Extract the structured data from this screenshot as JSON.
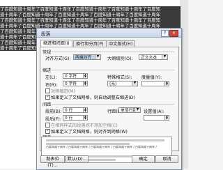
{
  "document": {
    "lines": [
      "了百度知道十周年了百度知道十周年了百度知道十周年了百度知道十周年了百度知",
      "道十周年了百度知道十周年了百度知道十周年了百度知道十周年了百度知道十周年",
      "了百度知道十周年了百度知道十周年了百度知道十周年了百度知道十周年了百度知",
      "道十周年了百度知道十周年了百度知道十周年了百度知道十周年了百度知道十周年",
      "了百度知道十周年了百度知道十周年了百度知道十周年了百度知道十周年了百度知",
      "道十周年了百度知道十周年了百度知道十周年了百度知道十周年了百度知道十周年",
      "了百度知道十周年了百度知道十周年了百度知道十周年了百度知道十周年了百度知",
      "道十周年了百度知道十周年了百度知道十周年了百度知道十周年了百度知道十周年"
    ]
  },
  "dialog": {
    "title": "段落",
    "help": "?",
    "close": "✕",
    "tabs": [
      "缩进和间距(I)",
      "换行和分页(P)",
      "中文版式(H)"
    ],
    "general": {
      "heading": "常规",
      "align_label": "对齐方式(G):",
      "align_value": "两端对齐",
      "outline_label": "大纲级别(O):",
      "outline_value": "正文文本"
    },
    "indent": {
      "heading": "缩进",
      "left_label": "左(L):",
      "left_value": "0 字符",
      "right_label": "右(R):",
      "right_value": "0 字符",
      "special_label": "特殊格式(S):",
      "special_value": "(无)",
      "by_label": "度量值(Y):",
      "mirror_label": "对称缩进(M)",
      "auto_adjust_label": "如果定义了文档网格，则自动调整右缩进(D)"
    },
    "spacing": {
      "heading": "间距",
      "before_label": "段前(B):",
      "before_value": "0 行",
      "after_label": "段后(F):",
      "after_value": "0 行",
      "line_label": "行距(N):",
      "line_value": "单倍行距",
      "at_label": "设置值(A):",
      "no_space_label": "在相同样式的段落间不添加空格(C)",
      "snap_label": "如果定义了文档网格，则对齐到网格(W)"
    },
    "preview": {
      "heading": "预览",
      "sample_text": "百度知道十周年了百度知道十周年了百度知道十周年了百度知道十周年了百度知道十周年了"
    },
    "buttons": {
      "tabs": "制表位(T)...",
      "default": "默认(D)...",
      "ok": "确定",
      "cancel": "取消"
    }
  }
}
